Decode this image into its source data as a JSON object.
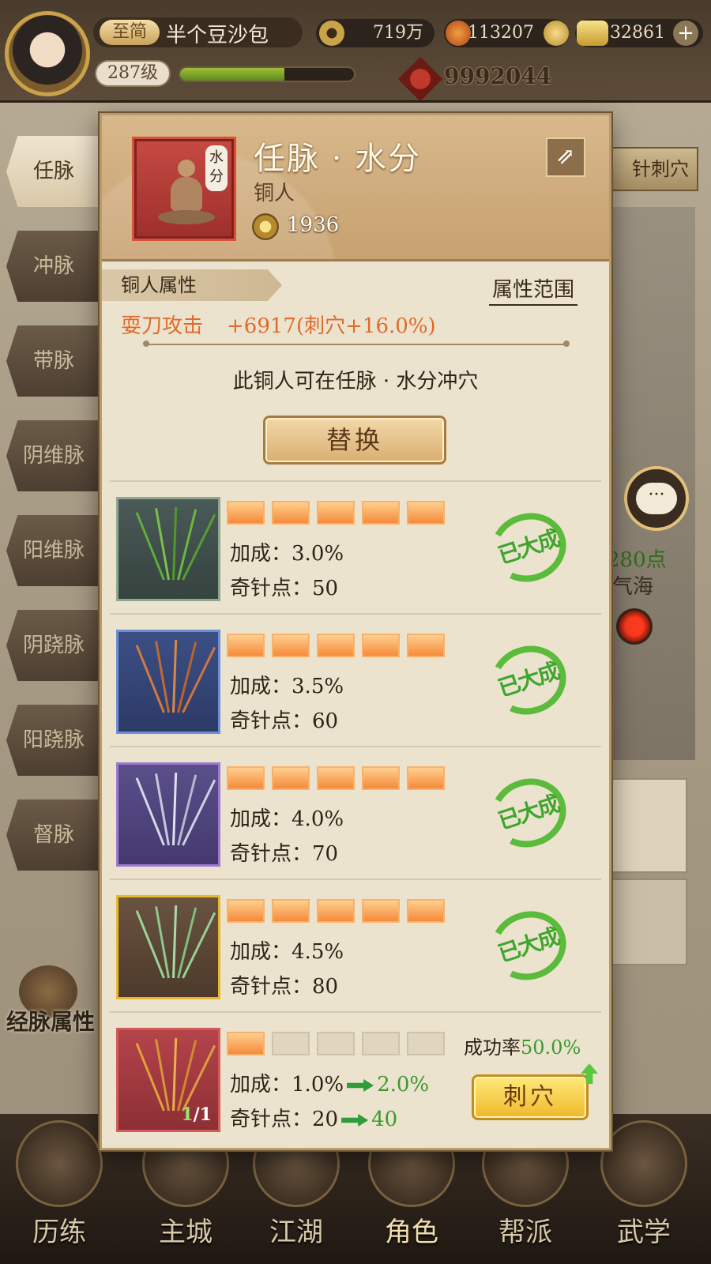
{
  "header": {
    "vip": "至简",
    "player_name": "半个豆沙包",
    "level": "287级",
    "exp_fraction": 0.6,
    "coins": "719万",
    "currency2": "113207",
    "gold": "32861",
    "power": "9992044"
  },
  "background": {
    "meridians": [
      "任脉",
      "冲脉",
      "带脉",
      "阴维脉",
      "阳维脉",
      "阴跷脉",
      "阳跷脉",
      "督脉"
    ],
    "right_button": "针刺穴",
    "points_label": "280点",
    "acupoint_label": "气海",
    "attr_book_label": "经脉属性"
  },
  "bottom_nav": [
    "历练",
    "主城",
    "江湖",
    "角色",
    "帮派",
    "武学"
  ],
  "modal": {
    "title": "任脉 · 水分",
    "subtitle": "铜人",
    "acupoint_tag": "水分",
    "power": "1936",
    "section_title": "铜人属性",
    "range_link": "属性范围",
    "attr_name": "耍刀攻击",
    "attr_value": "+6917(刺穴+16.0%)",
    "hint": "此铜人可在任脉 · 水分冲穴",
    "replace_button": "替换",
    "bonus_label": "加成：",
    "points_label": "奇针点：",
    "stamp_text": "已大成",
    "success_label": "成功率",
    "success_value": "50.0%",
    "acupuncture_button": "刺穴",
    "needles": [
      {
        "bonus": "3.0%",
        "points": "50",
        "level": 5
      },
      {
        "bonus": "3.5%",
        "points": "60",
        "level": 5
      },
      {
        "bonus": "4.0%",
        "points": "70",
        "level": 5
      },
      {
        "bonus": "4.5%",
        "points": "80",
        "level": 5
      },
      {
        "bonus": "1.0%",
        "bonus_next": "2.0%",
        "points": "20",
        "points_next": "40",
        "level": 1,
        "count_have": "1",
        "count_need": "/1"
      }
    ]
  },
  "colors": {
    "accent_orange": "#e06a2a",
    "mastered_green": "#3fa52d",
    "star_filled": "#f58a3a"
  }
}
